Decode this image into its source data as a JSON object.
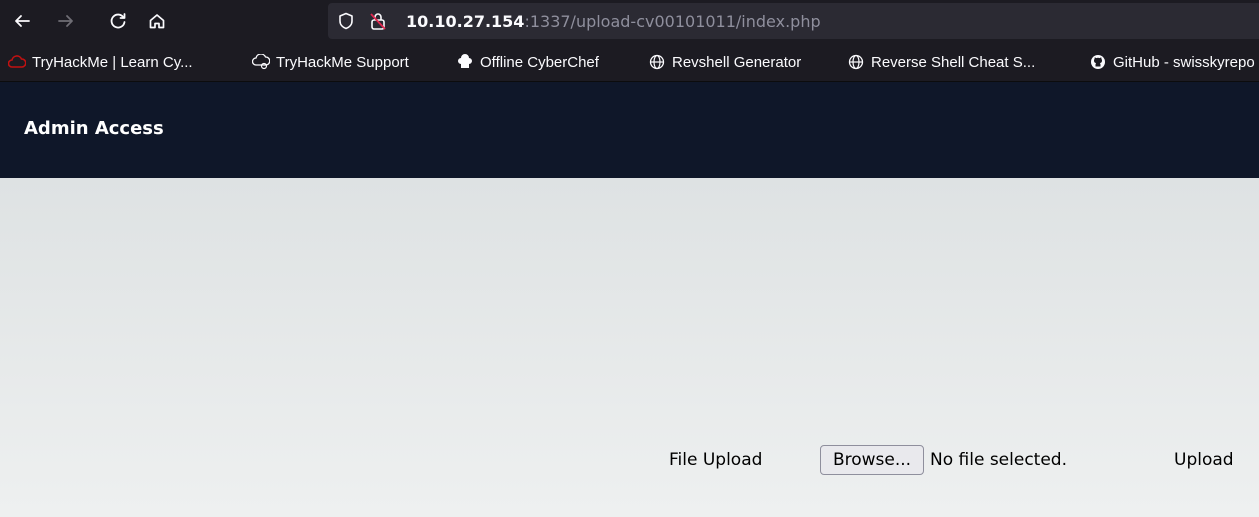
{
  "browser": {
    "url_host": "10.10.27.154",
    "url_rest": ":1337/upload-cv00101011/index.php",
    "bookmarks": [
      {
        "label": "TryHackMe | Learn Cy...",
        "icon": "tryhackme-icon"
      },
      {
        "label": "TryHackMe Support",
        "icon": "support-cloud-icon"
      },
      {
        "label": "Offline CyberChef",
        "icon": "chef-hat-icon"
      },
      {
        "label": "Revshell Generator",
        "icon": "globe-icon"
      },
      {
        "label": "Reverse Shell Cheat S...",
        "icon": "globe-icon"
      },
      {
        "label": "GitHub - swisskyrepo",
        "icon": "github-icon"
      }
    ]
  },
  "header": {
    "brand": "Admin Access"
  },
  "upload": {
    "label": "File Upload",
    "browse_label": "Browse...",
    "file_status": "No file selected.",
    "submit_label": "Upload"
  },
  "colors": {
    "chrome": "#1c1b22",
    "urlbar": "#2b2a33",
    "header": "#0f1729",
    "content": "#e6e8e9"
  }
}
